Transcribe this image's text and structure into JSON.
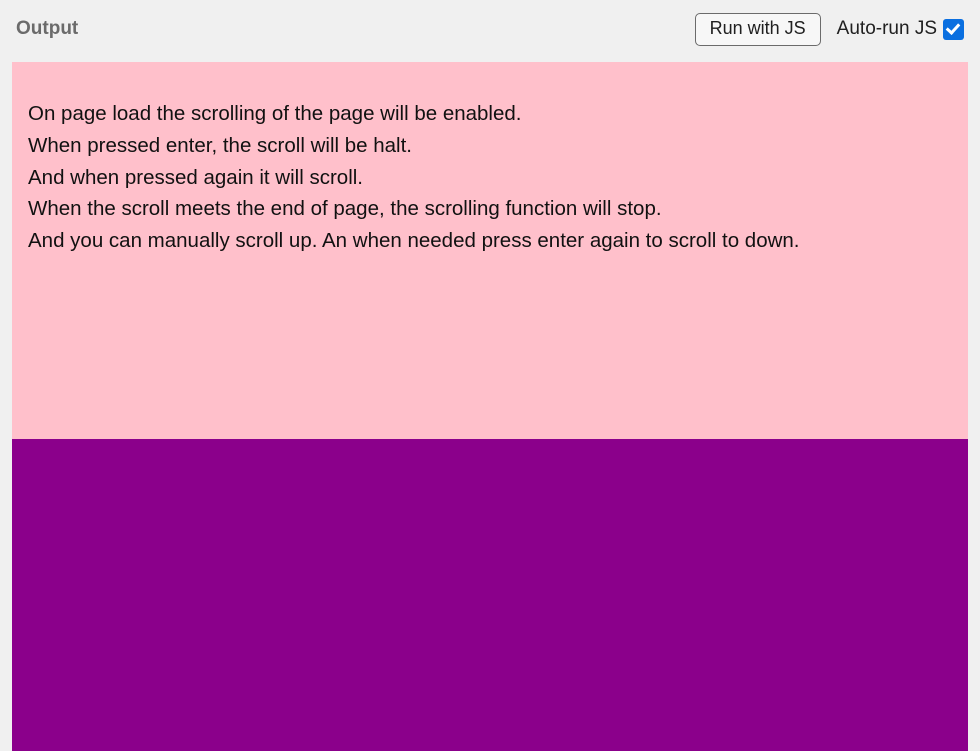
{
  "header": {
    "title": "Output",
    "run_button_label": "Run with JS",
    "autorun_label": "Auto-run JS",
    "autorun_checked": true
  },
  "content": {
    "lines": [
      "On page load the scrolling of the page will be enabled.",
      "When pressed enter, the scroll will be halt.",
      "And when pressed again it will scroll.",
      "When the scroll meets the end of page, the scrolling function will stop.",
      "And you can manually scroll up. An when needed press enter again to scroll to down."
    ]
  },
  "colors": {
    "section1_bg": "#ffc0cb",
    "section2_bg": "#8b008b",
    "page_bg": "#f0f0f0",
    "checkbox_accent": "#0a6fe0"
  }
}
